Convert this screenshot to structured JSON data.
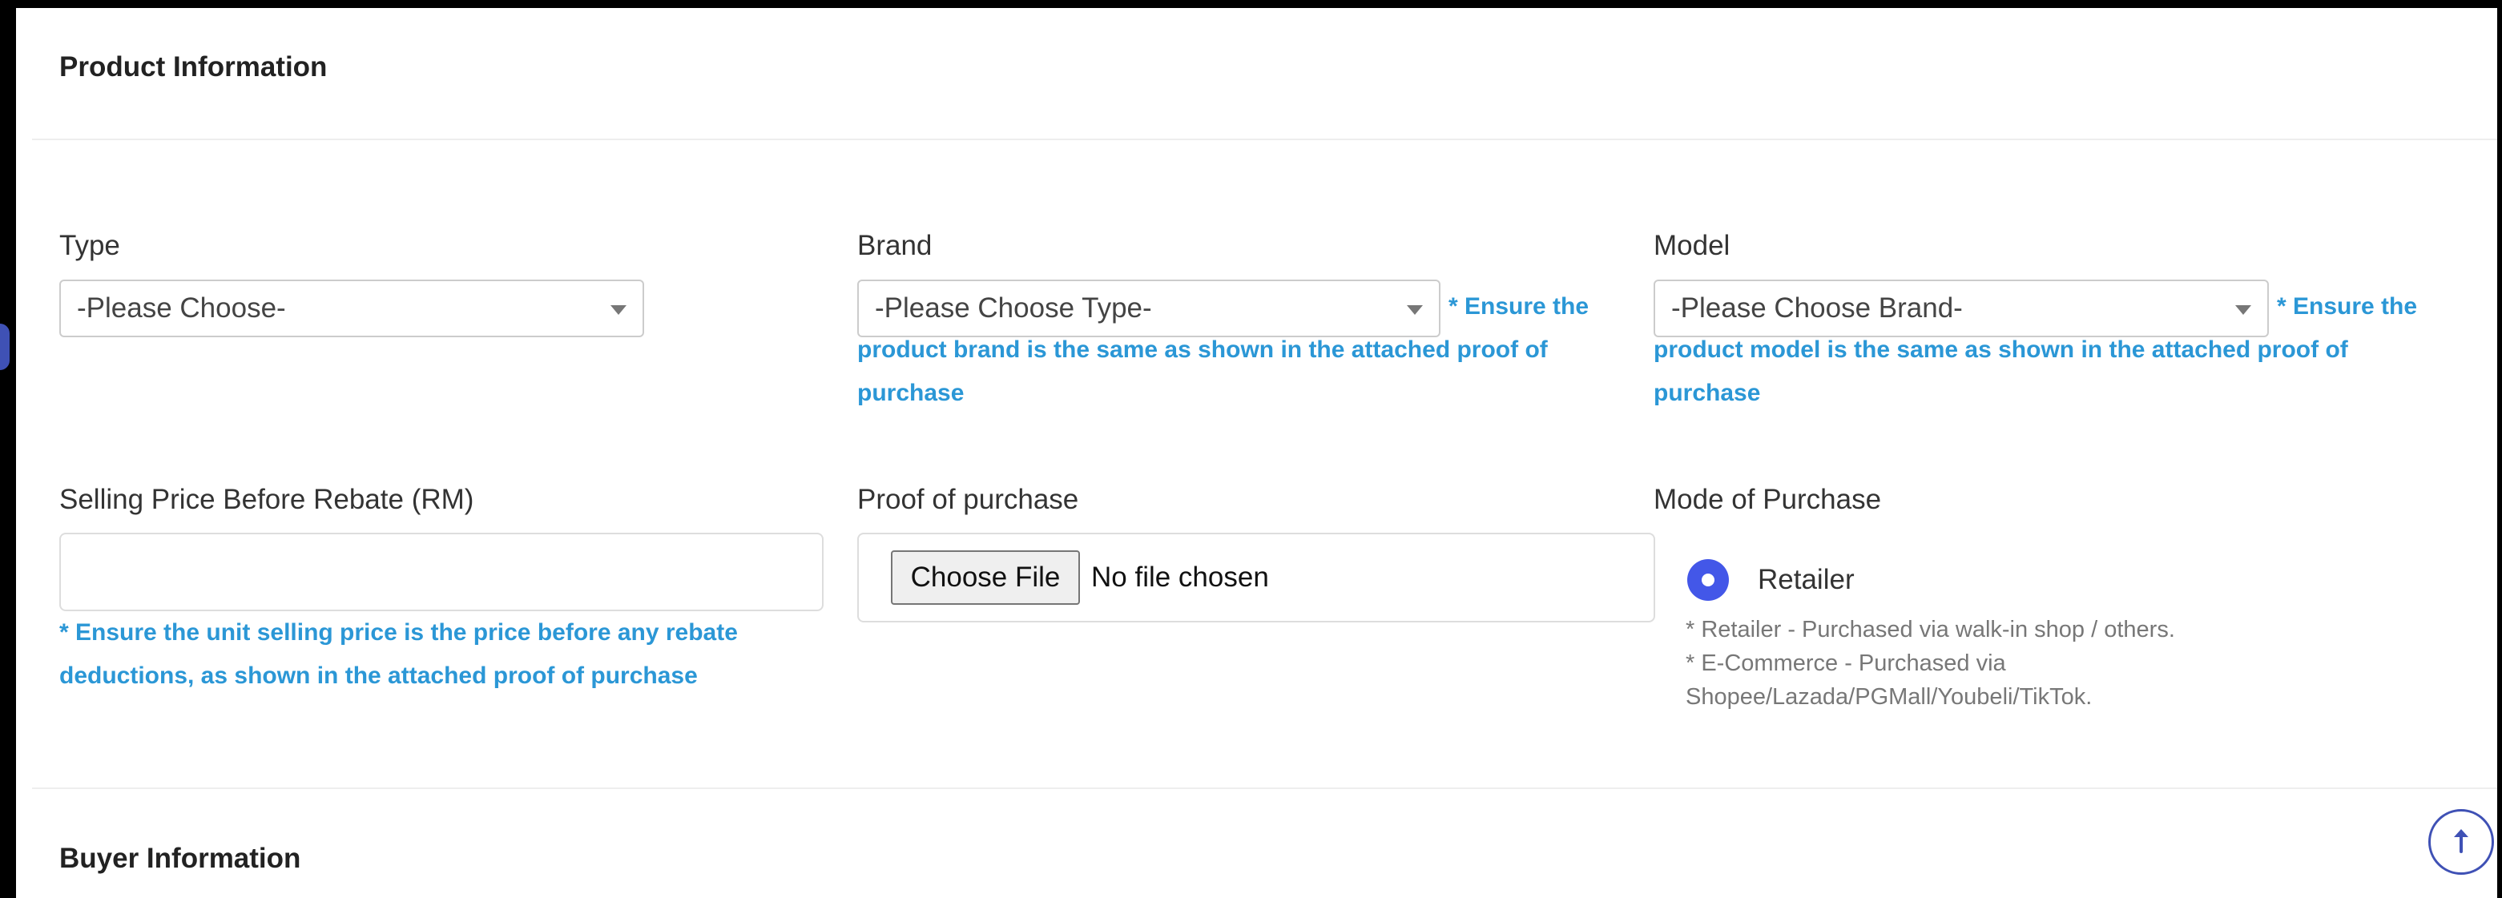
{
  "sections": {
    "product_title": "Product Information",
    "buyer_title": "Buyer Information"
  },
  "fields": {
    "type": {
      "label": "Type",
      "selected": "-Please Choose-"
    },
    "brand": {
      "label": "Brand",
      "selected": "-Please Choose Type-",
      "hint": "* Ensure the product brand is the same as shown in the attached proof of purchase"
    },
    "model": {
      "label": "Model",
      "selected": "-Please Choose Brand-",
      "hint": "* Ensure the product model is the same as shown in the attached proof of purchase"
    },
    "selling_price": {
      "label": "Selling Price Before Rebate (RM)",
      "value": "",
      "hint": "* Ensure the unit selling price is the price before any rebate deductions, as shown in the attached proof of purchase"
    },
    "proof": {
      "label": "Proof of purchase",
      "button": "Choose File",
      "status": "No file chosen"
    },
    "mode": {
      "label": "Mode of Purchase",
      "option": "Retailer",
      "note_retailer": "* Retailer - Purchased via walk-in shop / others.",
      "note_ecommerce": "* E-Commerce - Purchased via Shopee/Lazada/PGMall/Youbeli/TikTok."
    }
  },
  "icons": {
    "dropdown": "caret-down-icon",
    "scroll_top": "arrow-up-icon"
  },
  "colors": {
    "hint_blue": "#2b97d6",
    "radio_accent": "#4357e8",
    "scroll_border": "#3f51b5"
  }
}
